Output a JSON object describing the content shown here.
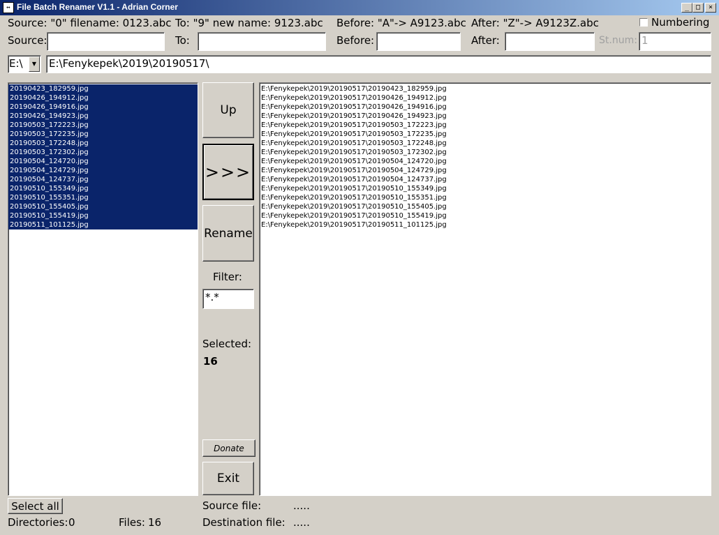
{
  "window": {
    "title": "File Batch Renamer V1.1 - Adrian Corner",
    "icon_glyph": "↔",
    "controls": {
      "minimize": "_",
      "maximize": "□",
      "close": "×"
    }
  },
  "hints": {
    "source": "Source: \"0\" filename: 0123.abc",
    "to": "To: \"9\" new name: 9123.abc",
    "before": "Before: \"A\"-> A9123.abc",
    "after": "After: \"Z\"-> A9123Z.abc"
  },
  "numbering_label": "Numbering",
  "numbering_checked": false,
  "fields": {
    "source_label": "Source:",
    "source_value": "",
    "to_label": "To:",
    "to_value": "",
    "before_label": "Before:",
    "before_value": "",
    "after_label": "After:",
    "after_value": "",
    "stnum_label": "St.num:",
    "stnum_value": "1"
  },
  "drive": {
    "value": "E:\\",
    "arrow": "▼"
  },
  "path": "E:\\Fenykepek\\2019\\20190517\\",
  "source_files": [
    "20190423_182959.jpg",
    "20190426_194912.jpg",
    "20190426_194916.jpg",
    "20190426_194923.jpg",
    "20190503_172223.jpg",
    "20190503_172235.jpg",
    "20190503_172248.jpg",
    "20190503_172302.jpg",
    "20190504_124720.jpg",
    "20190504_124729.jpg",
    "20190504_124737.jpg",
    "20190510_155349.jpg",
    "20190510_155351.jpg",
    "20190510_155405.jpg",
    "20190510_155419.jpg",
    "20190511_101125.jpg"
  ],
  "dest_files": [
    "E:\\Fenykepek\\2019\\20190517\\20190423_182959.jpg",
    "E:\\Fenykepek\\2019\\20190517\\20190426_194912.jpg",
    "E:\\Fenykepek\\2019\\20190517\\20190426_194916.jpg",
    "E:\\Fenykepek\\2019\\20190517\\20190426_194923.jpg",
    "E:\\Fenykepek\\2019\\20190517\\20190503_172223.jpg",
    "E:\\Fenykepek\\2019\\20190517\\20190503_172235.jpg",
    "E:\\Fenykepek\\2019\\20190517\\20190503_172248.jpg",
    "E:\\Fenykepek\\2019\\20190517\\20190503_172302.jpg",
    "E:\\Fenykepek\\2019\\20190517\\20190504_124720.jpg",
    "E:\\Fenykepek\\2019\\20190517\\20190504_124729.jpg",
    "E:\\Fenykepek\\2019\\20190517\\20190504_124737.jpg",
    "E:\\Fenykepek\\2019\\20190517\\20190510_155349.jpg",
    "E:\\Fenykepek\\2019\\20190517\\20190510_155351.jpg",
    "E:\\Fenykepek\\2019\\20190517\\20190510_155405.jpg",
    "E:\\Fenykepek\\2019\\20190517\\20190510_155419.jpg",
    "E:\\Fenykepek\\2019\\20190517\\20190511_101125.jpg"
  ],
  "buttons": {
    "up": "Up",
    "move": ">>>",
    "rename": "Rename",
    "donate": "Donate",
    "exit": "Exit",
    "select_all": "Select all"
  },
  "filter": {
    "label": "Filter:",
    "value": "*.*"
  },
  "selected": {
    "label": "Selected:",
    "count": "16"
  },
  "status": {
    "directories_label": "Directories:",
    "directories_value": "0",
    "files_label": "Files:",
    "files_value": "16",
    "source_file_label": "Source file:",
    "source_file_value": ".....",
    "dest_file_label": "Destination file:",
    "dest_file_value": "....."
  },
  "colors": {
    "face": "#d4d0c8",
    "selection": "#0a246a",
    "title_start": "#0a246a",
    "title_end": "#a6caf0"
  }
}
